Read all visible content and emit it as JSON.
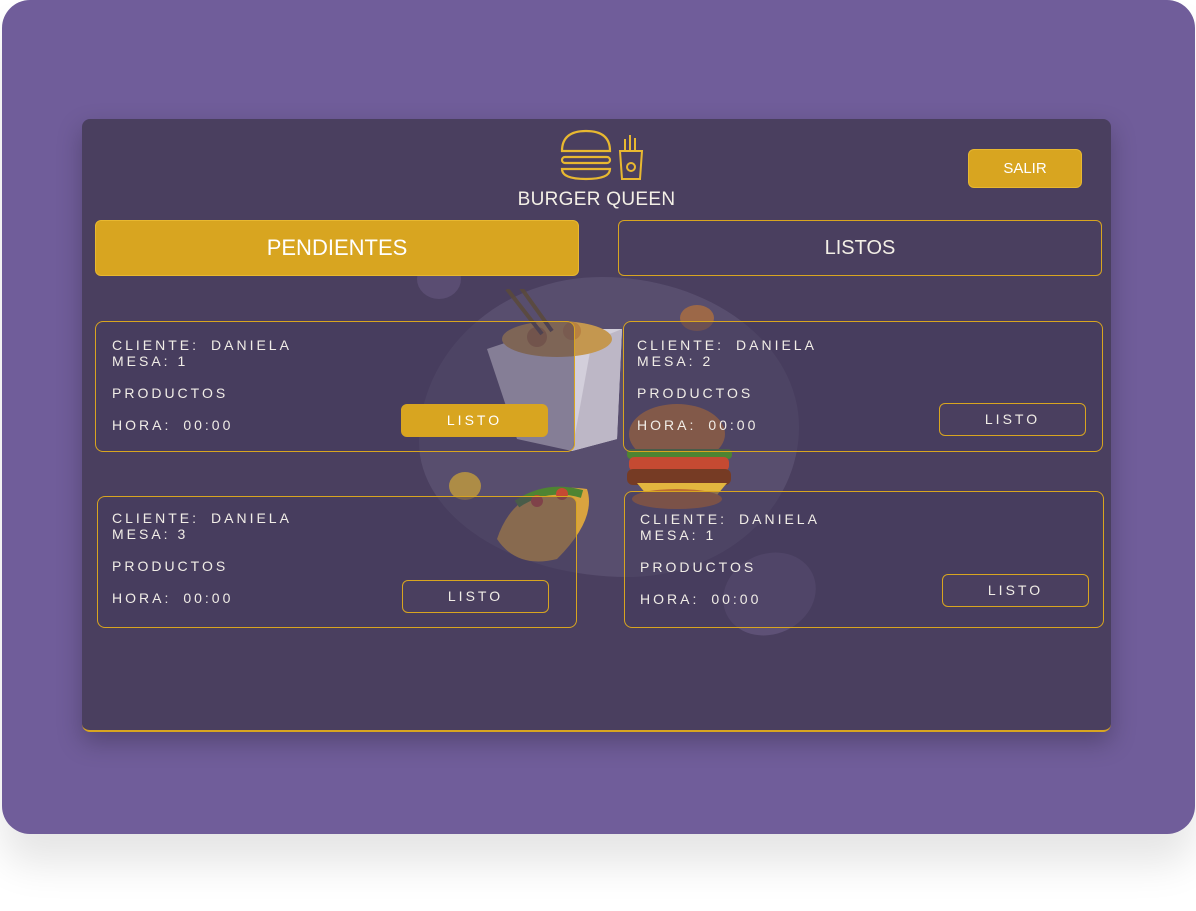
{
  "header": {
    "brand": "BURGER QUEEN",
    "logout_label": "SALIR"
  },
  "tabs": [
    {
      "label": "PENDIENTES",
      "active": true
    },
    {
      "label": "LISTOS",
      "active": false
    }
  ],
  "orders": [
    {
      "client_label": "CLIENTE:",
      "client": "DANIELA",
      "table_label": "MESA:",
      "table": "1",
      "products_label": "PRODUCTOS",
      "time_label": "HORA:",
      "time": "00:00",
      "button": "LISTO",
      "button_active": true
    },
    {
      "client_label": "CLIENTE:",
      "client": "DANIELA",
      "table_label": "MESA:",
      "table": "2",
      "products_label": "PRODUCTOS",
      "time_label": "HORA:",
      "time": "00:00",
      "button": "LISTO",
      "button_active": false
    },
    {
      "client_label": "CLIENTE:",
      "client": "DANIELA",
      "table_label": "MESA:",
      "table": "3",
      "products_label": "PRODUCTOS",
      "time_label": "HORA:",
      "time": "00:00",
      "button": "LISTO",
      "button_active": false
    },
    {
      "client_label": "CLIENTE:",
      "client": "DANIELA",
      "table_label": "MESA:",
      "table": "1",
      "products_label": "PRODUCTOS",
      "time_label": "HORA:",
      "time": "00:00",
      "button": "LISTO",
      "button_active": false
    }
  ],
  "colors": {
    "background": "#705d9a",
    "panel": "#4a3f5f",
    "accent": "#d8a520",
    "text": "#f3efe6"
  },
  "icons": [
    "burger-icon",
    "fries-icon"
  ]
}
